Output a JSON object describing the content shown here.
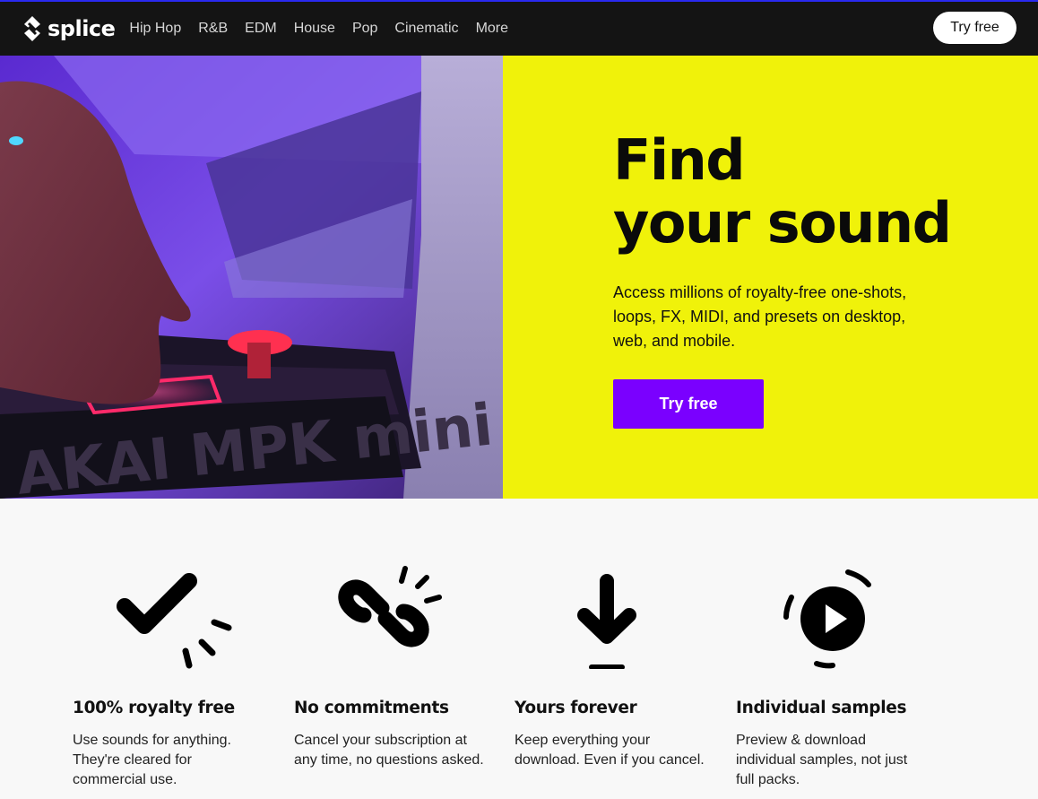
{
  "brand": {
    "name": "splice",
    "accent": "#7a00ff",
    "hero_bg": "#f0f20a",
    "nav_bg": "#141414"
  },
  "nav": {
    "items": [
      {
        "label": "Hip Hop"
      },
      {
        "label": "R&B"
      },
      {
        "label": "EDM"
      },
      {
        "label": "House"
      },
      {
        "label": "Pop"
      },
      {
        "label": "Cinematic"
      },
      {
        "label": "More"
      }
    ],
    "cta_label": "Try free"
  },
  "hero": {
    "title_line1": "Find",
    "title_line2": "your sound",
    "subtitle": "Access millions of royalty-free one-shots, loops, FX, MIDI, and presets on desktop, web, and mobile.",
    "cta_label": "Try free",
    "photo_text": "AKAI MPK mini"
  },
  "features": [
    {
      "icon": "checkmark-icon",
      "title": "100% royalty free",
      "body": "Use sounds for anything. They're cleared for commercial use."
    },
    {
      "icon": "broken-link-icon",
      "title": "No commitments",
      "body": "Cancel your subscription at any time, no questions asked."
    },
    {
      "icon": "download-icon",
      "title": "Yours forever",
      "body": "Keep everything your download. Even if you cancel."
    },
    {
      "icon": "play-icon",
      "title": "Individual samples",
      "body": "Preview & download individual samples, not just full packs."
    }
  ]
}
